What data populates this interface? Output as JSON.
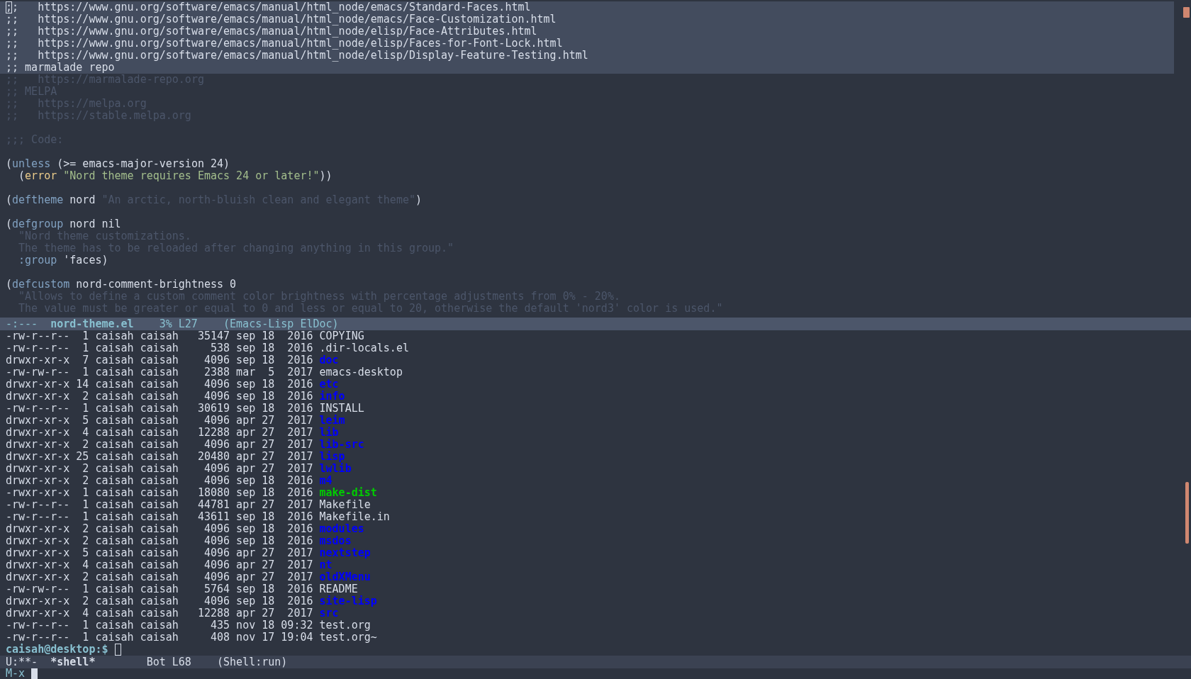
{
  "editor": {
    "focused": false,
    "lines": [
      {
        "selected": true,
        "segments": [
          {
            "text": ";",
            "kind": "cursor"
          },
          {
            "text": ";   https://www.gnu.org/software/emacs/manual/html_node/emacs/Standard-Faces.html",
            "kind": "comment"
          }
        ]
      },
      {
        "selected": true,
        "segments": [
          {
            "text": ";;   https://www.gnu.org/software/emacs/manual/html_node/emacs/Face-Customization.html",
            "kind": "comment"
          }
        ]
      },
      {
        "selected": true,
        "segments": [
          {
            "text": ";;   https://www.gnu.org/software/emacs/manual/html_node/elisp/Face-Attributes.html",
            "kind": "comment"
          }
        ]
      },
      {
        "selected": true,
        "segments": [
          {
            "text": ";;   https://www.gnu.org/software/emacs/manual/html_node/elisp/Faces-for-Font-Lock.html",
            "kind": "comment"
          }
        ]
      },
      {
        "selected": true,
        "segments": [
          {
            "text": ";;   https://www.gnu.org/software/emacs/manual/html_node/elisp/Display-Feature-Testing.html",
            "kind": "comment"
          }
        ]
      },
      {
        "selected": true,
        "segments": [
          {
            "text": ";; marmalade repo",
            "kind": "comment"
          }
        ]
      },
      {
        "selected": false,
        "segments": [
          {
            "text": ";;   https://marmalade-repo.org",
            "kind": "comment"
          }
        ]
      },
      {
        "selected": false,
        "segments": [
          {
            "text": ";; MELPA",
            "kind": "comment"
          }
        ]
      },
      {
        "selected": false,
        "segments": [
          {
            "text": ";;   https://melpa.org",
            "kind": "comment"
          }
        ]
      },
      {
        "selected": false,
        "segments": [
          {
            "text": ";;   https://stable.melpa.org",
            "kind": "comment"
          }
        ]
      },
      {
        "selected": false
      },
      {
        "selected": false,
        "segments": [
          {
            "text": ";;; Code:",
            "kind": "comment"
          }
        ]
      },
      {
        "selected": false
      },
      {
        "selected": false,
        "segments": [
          {
            "text": "(",
            "kind": "plain"
          },
          {
            "text": "unless",
            "kind": "keyword"
          },
          {
            "text": " (>= emacs-major-version 24)",
            "kind": "plain"
          }
        ]
      },
      {
        "selected": false,
        "segments": [
          {
            "text": "  (",
            "kind": "plain"
          },
          {
            "text": "error",
            "kind": "warning"
          },
          {
            "text": " \"Nord theme requires Emacs 24 or later!\"",
            "kind": "string"
          },
          {
            "text": "))",
            "kind": "plain"
          }
        ]
      },
      {
        "selected": false
      },
      {
        "selected": false,
        "segments": [
          {
            "text": "(",
            "kind": "plain"
          },
          {
            "text": "deftheme",
            "kind": "keyword"
          },
          {
            "text": " nord ",
            "kind": "plain"
          },
          {
            "text": "\"An arctic, north-bluish clean and elegant theme\"",
            "kind": "doc"
          },
          {
            "text": ")",
            "kind": "plain"
          }
        ]
      },
      {
        "selected": false
      },
      {
        "selected": false,
        "segments": [
          {
            "text": "(",
            "kind": "plain"
          },
          {
            "text": "defgroup",
            "kind": "keyword"
          },
          {
            "text": " nord nil",
            "kind": "plain"
          }
        ]
      },
      {
        "selected": false,
        "segments": [
          {
            "text": "  \"Nord theme customizations.",
            "kind": "doc"
          }
        ]
      },
      {
        "selected": false,
        "segments": [
          {
            "text": "  The theme has to be reloaded after changing anything in this group.\"",
            "kind": "doc"
          }
        ]
      },
      {
        "selected": false,
        "segments": [
          {
            "text": "  :group",
            "kind": "keyword"
          },
          {
            "text": " 'faces)",
            "kind": "plain"
          }
        ]
      },
      {
        "selected": false
      },
      {
        "selected": false,
        "segments": [
          {
            "text": "(",
            "kind": "plain"
          },
          {
            "text": "defcustom",
            "kind": "keyword"
          },
          {
            "text": " nord-comment-brightness 0",
            "kind": "plain"
          }
        ]
      },
      {
        "selected": false,
        "segments": [
          {
            "text": "  \"Allows to define a custom comment color brightness with percentage adjustments from 0% - 20%.",
            "kind": "doc"
          }
        ]
      },
      {
        "selected": false,
        "segments": [
          {
            "text": "  The value must be greater or equal to 0 and less or equal to 20, otherwise the default 'nord3' color is used.\"",
            "kind": "doc"
          }
        ]
      }
    ]
  },
  "editor_mode_line": {
    "active": true,
    "status": "-:---",
    "buffer": "nord-theme.el",
    "position": "3% L27",
    "mode": "(Emacs-Lisp ElDoc)"
  },
  "shell": {
    "focused": false,
    "listing": [
      {
        "details": "-rw-r--r--  1 caisah caisah   35147 sep 18  2016",
        "name": "COPYING",
        "kind": "file"
      },
      {
        "details": "-rw-r--r--  1 caisah caisah     538 sep 18  2016",
        "name": ".dir-locals.el",
        "kind": "file"
      },
      {
        "details": "drwxr-xr-x  7 caisah caisah    4096 sep 18  2016",
        "name": "doc",
        "kind": "directory"
      },
      {
        "details": "-rw-rw-r--  1 caisah caisah    2388 mar  5  2017",
        "name": "emacs-desktop",
        "kind": "file"
      },
      {
        "details": "drwxr-xr-x 14 caisah caisah    4096 sep 18  2016",
        "name": "etc",
        "kind": "directory"
      },
      {
        "details": "drwxr-xr-x  2 caisah caisah    4096 sep 18  2016",
        "name": "info",
        "kind": "directory"
      },
      {
        "details": "-rw-r--r--  1 caisah caisah   30619 sep 18  2016",
        "name": "INSTALL",
        "kind": "file"
      },
      {
        "details": "drwxr-xr-x  5 caisah caisah    4096 apr 27  2017",
        "name": "leim",
        "kind": "directory"
      },
      {
        "details": "drwxr-xr-x  4 caisah caisah   12288 apr 27  2017",
        "name": "lib",
        "kind": "directory"
      },
      {
        "details": "drwxr-xr-x  2 caisah caisah    4096 apr 27  2017",
        "name": "lib-src",
        "kind": "directory"
      },
      {
        "details": "drwxr-xr-x 25 caisah caisah   20480 apr 27  2017",
        "name": "lisp",
        "kind": "directory"
      },
      {
        "details": "drwxr-xr-x  2 caisah caisah    4096 apr 27  2017",
        "name": "lwlib",
        "kind": "directory"
      },
      {
        "details": "drwxr-xr-x  2 caisah caisah    4096 sep 18  2016",
        "name": "m4",
        "kind": "directory"
      },
      {
        "details": "-rwxr-xr-x  1 caisah caisah   18080 sep 18  2016",
        "name": "make-dist",
        "kind": "executable"
      },
      {
        "details": "-rw-r--r--  1 caisah caisah   44781 apr 27  2017",
        "name": "Makefile",
        "kind": "file"
      },
      {
        "details": "-rw-r--r--  1 caisah caisah   43611 sep 18  2016",
        "name": "Makefile.in",
        "kind": "file"
      },
      {
        "details": "drwxr-xr-x  2 caisah caisah    4096 sep 18  2016",
        "name": "modules",
        "kind": "directory"
      },
      {
        "details": "drwxr-xr-x  2 caisah caisah    4096 sep 18  2016",
        "name": "msdos",
        "kind": "directory"
      },
      {
        "details": "drwxr-xr-x  5 caisah caisah    4096 apr 27  2017",
        "name": "nextstep",
        "kind": "directory"
      },
      {
        "details": "drwxr-xr-x  4 caisah caisah    4096 apr 27  2017",
        "name": "nt",
        "kind": "directory"
      },
      {
        "details": "drwxr-xr-x  2 caisah caisah    4096 apr 27  2017",
        "name": "oldXMenu",
        "kind": "directory"
      },
      {
        "details": "-rw-rw-r--  1 caisah caisah    5764 sep 18  2016",
        "name": "README",
        "kind": "file"
      },
      {
        "details": "drwxr-xr-x  2 caisah caisah    4096 sep 18  2016",
        "name": "site-lisp",
        "kind": "directory"
      },
      {
        "details": "drwxr-xr-x  4 caisah caisah   12288 apr 27  2017",
        "name": "src",
        "kind": "directory"
      },
      {
        "details": "-rw-r--r--  1 caisah caisah     435 nov 18 09:32",
        "name": "test.org",
        "kind": "file"
      },
      {
        "details": "-rw-r--r--  1 caisah caisah     408 nov 17 19:04",
        "name": "test.org~",
        "kind": "file"
      }
    ],
    "prompt": "caisah@desktop:$"
  },
  "shell_mode_line": {
    "active": false,
    "status": "U:**-",
    "buffer": "*shell*",
    "position": "Bot L68",
    "mode": "(Shell:run)"
  },
  "minibuffer": {
    "focused": true,
    "prompt": "M-x"
  }
}
